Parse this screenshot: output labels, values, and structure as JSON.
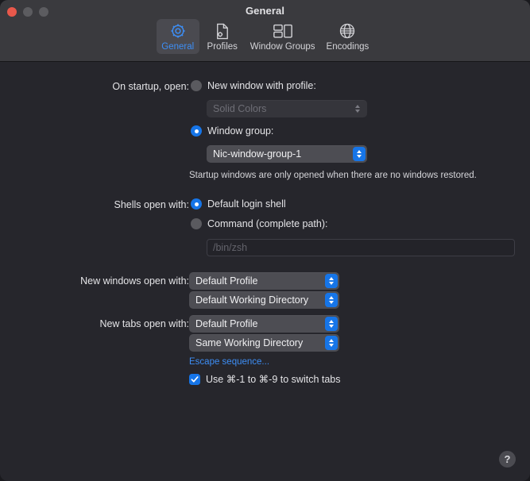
{
  "window": {
    "title": "General",
    "traffic_lights": [
      "close",
      "minimize",
      "maximize"
    ]
  },
  "toolbar": {
    "tabs": [
      {
        "label": "General",
        "icon": "gear-icon",
        "selected": true
      },
      {
        "label": "Profiles",
        "icon": "document-icon",
        "selected": false
      },
      {
        "label": "Window Groups",
        "icon": "window-groups-icon",
        "selected": false
      },
      {
        "label": "Encodings",
        "icon": "globe-icon",
        "selected": false
      }
    ]
  },
  "form": {
    "startup": {
      "label": "On startup, open:",
      "option_new_window": {
        "label": "New window with profile:",
        "selected": false
      },
      "profile_select": {
        "value": "Solid Colors",
        "disabled": true
      },
      "option_window_group": {
        "label": "Window group:",
        "selected": true
      },
      "window_group_select": {
        "value": "Nic-window-group-1",
        "disabled": false
      },
      "hint": "Startup windows are only opened when there are no windows restored."
    },
    "shells": {
      "label": "Shells open with:",
      "option_default_shell": {
        "label": "Default login shell",
        "selected": true
      },
      "option_command": {
        "label": "Command (complete path):",
        "selected": false
      },
      "command_field": {
        "value": "",
        "placeholder": "/bin/zsh",
        "disabled": true
      }
    },
    "new_windows": {
      "label": "New windows open with:",
      "profile_select": {
        "value": "Default Profile"
      },
      "directory_select": {
        "value": "Default Working Directory"
      }
    },
    "new_tabs": {
      "label": "New tabs open with:",
      "profile_select": {
        "value": "Default Profile"
      },
      "directory_select": {
        "value": "Same Working Directory"
      }
    },
    "escape_sequence_link": "Escape sequence...",
    "switch_tabs_checkbox": {
      "label": "Use ⌘-1 to ⌘-9 to switch tabs",
      "checked": true
    }
  },
  "help": {
    "label": "?"
  },
  "colors": {
    "accent": "#1675e8",
    "link": "#3d8ef5",
    "toolbar_bg": "#3a3a3e",
    "content_bg": "#26262c",
    "close_button": "#e8584b"
  }
}
